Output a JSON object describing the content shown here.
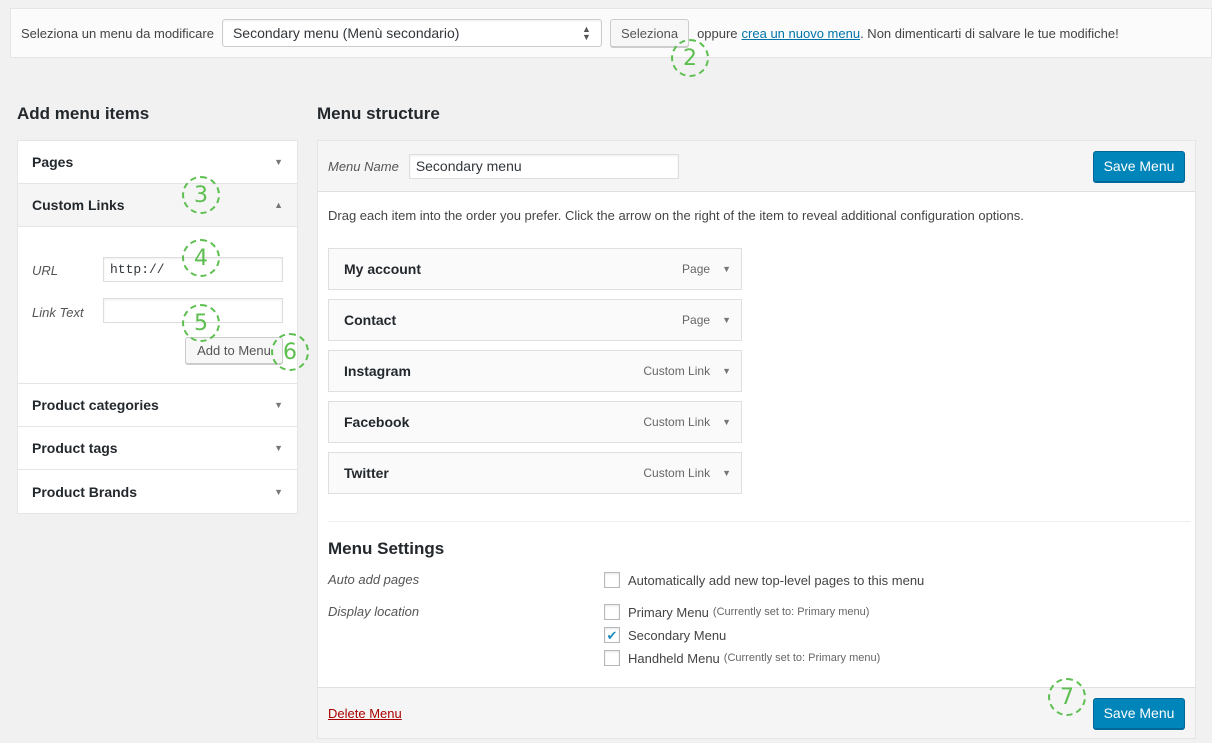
{
  "topbar": {
    "select_label": "Seleziona un menu da modificare",
    "select_value": "Secondary menu (Menù secondario)",
    "select_button": "Seleziona",
    "or_text": "oppure",
    "create_link": "crea un nuovo menu",
    "save_note": ". Non dimenticarti di salvare le tue modifiche!"
  },
  "markers": {
    "m2": "2",
    "m3": "3",
    "m4": "4",
    "m5": "5",
    "m6": "6",
    "m7": "7"
  },
  "add_items": {
    "title": "Add menu items",
    "pages": "Pages",
    "custom_links": "Custom Links",
    "url_label": "URL",
    "url_value": "http://",
    "link_text_label": "Link Text",
    "link_text_value": "",
    "add_button": "Add to Menu",
    "product_categories": "Product categories",
    "product_tags": "Product tags",
    "product_brands": "Product Brands"
  },
  "structure": {
    "title": "Menu structure",
    "menu_name_label": "Menu Name",
    "menu_name_value": "Secondary menu",
    "save_button": "Save Menu",
    "instructions": "Drag each item into the order you prefer. Click the arrow on the right of the item to reveal additional configuration options.",
    "items": [
      {
        "label": "My account",
        "type": "Page"
      },
      {
        "label": "Contact",
        "type": "Page"
      },
      {
        "label": "Instagram",
        "type": "Custom Link"
      },
      {
        "label": "Facebook",
        "type": "Custom Link"
      },
      {
        "label": "Twitter",
        "type": "Custom Link"
      }
    ],
    "settings_title": "Menu Settings",
    "auto_add_label": "Auto add pages",
    "auto_add_option": "Automatically add new top-level pages to this menu",
    "display_location_label": "Display location",
    "locations": [
      {
        "label": "Primary Menu",
        "note": "(Currently set to: Primary menu)",
        "checked": false
      },
      {
        "label": "Secondary Menu",
        "note": "",
        "checked": true
      },
      {
        "label": "Handheld Menu",
        "note": "(Currently set to: Primary menu)",
        "checked": false
      }
    ],
    "delete_link": "Delete Menu",
    "save_button_bottom": "Save Menu"
  },
  "colors": {
    "primary": "#0085ba",
    "marker": "#5cbf4f",
    "link": "#0073aa",
    "delete": "#a00000"
  }
}
